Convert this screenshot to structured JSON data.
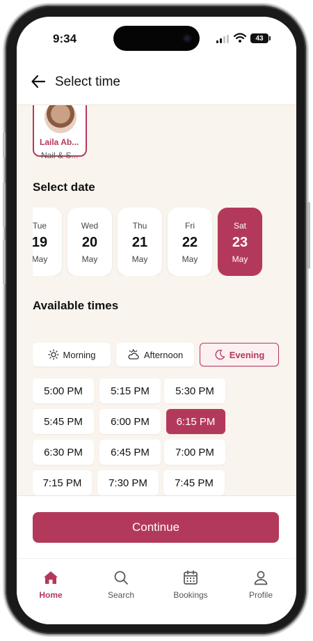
{
  "status_bar": {
    "time": "9:34",
    "battery": "43"
  },
  "header": {
    "title": "Select time"
  },
  "staff": {
    "name": "Laila Ab...",
    "role": "Nail & S..."
  },
  "date_section": {
    "title": "Select date",
    "dates": [
      {
        "day": "Tue",
        "date": "19",
        "month": "May",
        "selected": false
      },
      {
        "day": "Wed",
        "date": "20",
        "month": "May",
        "selected": false
      },
      {
        "day": "Thu",
        "date": "21",
        "month": "May",
        "selected": false
      },
      {
        "day": "Fri",
        "date": "22",
        "month": "May",
        "selected": false
      },
      {
        "day": "Sat",
        "date": "23",
        "month": "May",
        "selected": true
      }
    ]
  },
  "times_section": {
    "title": "Available times",
    "periods": [
      {
        "label": "Morning",
        "icon": "sun-icon",
        "active": false
      },
      {
        "label": "Afternoon",
        "icon": "partly-cloudy-icon",
        "active": false
      },
      {
        "label": "Evening",
        "icon": "moon-icon",
        "active": true
      }
    ],
    "slots": [
      "5:00 PM",
      "5:15 PM",
      "5:30 PM",
      "5:45 PM",
      "6:00 PM",
      "6:15 PM",
      "6:30 PM",
      "6:45 PM",
      "7:00 PM",
      "7:15 PM",
      "7:30 PM",
      "7:45 PM"
    ],
    "selected_slot": "6:15 PM"
  },
  "continue_label": "Continue",
  "tab_bar": {
    "items": [
      {
        "label": "Home",
        "icon": "home-icon",
        "active": true
      },
      {
        "label": "Search",
        "icon": "search-icon",
        "active": false
      },
      {
        "label": "Bookings",
        "icon": "calendar-icon",
        "active": false
      },
      {
        "label": "Profile",
        "icon": "person-icon",
        "active": false
      }
    ]
  },
  "colors": {
    "accent": "#b3395b",
    "background": "#faf4ee"
  }
}
